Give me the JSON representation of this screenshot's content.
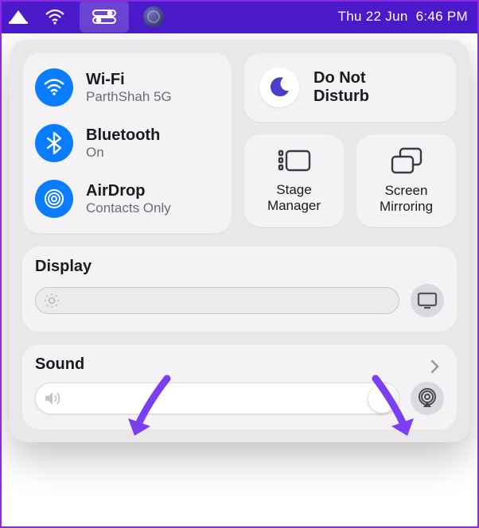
{
  "menubar": {
    "date": "Thu 22 Jun",
    "time": "6:46 PM"
  },
  "connectivity": {
    "wifi": {
      "title": "Wi-Fi",
      "subtitle": "ParthShah 5G"
    },
    "bluetooth": {
      "title": "Bluetooth",
      "subtitle": "On"
    },
    "airdrop": {
      "title": "AirDrop",
      "subtitle": "Contacts Only"
    }
  },
  "focus": {
    "title_line1": "Do Not",
    "title_line2": "Disturb"
  },
  "toggles": {
    "stage": {
      "line1": "Stage",
      "line2": "Manager"
    },
    "mirror": {
      "line1": "Screen",
      "line2": "Mirroring"
    }
  },
  "display": {
    "title": "Display"
  },
  "sound": {
    "title": "Sound"
  },
  "annotations": {
    "arrow_color": "#7b3ff2"
  }
}
